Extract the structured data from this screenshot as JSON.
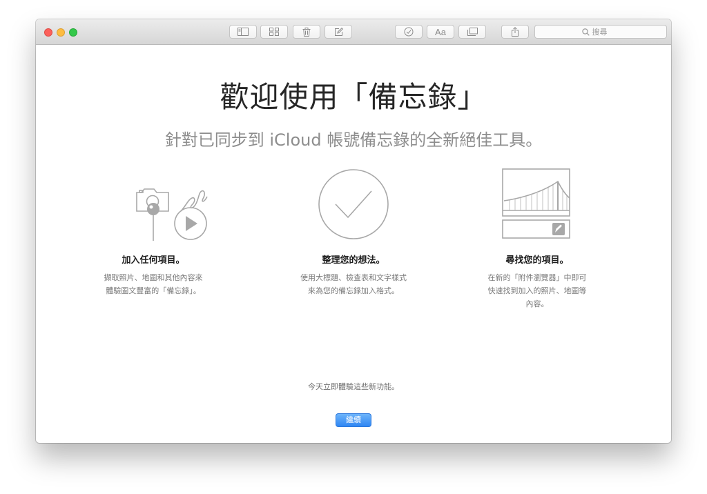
{
  "toolbar": {
    "buttons": [
      {
        "name": "sidebar-toggle-icon"
      },
      {
        "name": "attachments-grid-icon"
      },
      {
        "name": "trash-icon"
      },
      {
        "name": "compose-icon"
      },
      {
        "name": "checklist-icon"
      },
      {
        "name": "format-text-icon",
        "label": "Aa"
      },
      {
        "name": "gallery-icon"
      },
      {
        "name": "share-icon"
      }
    ],
    "search_placeholder": "搜尋"
  },
  "welcome": {
    "title": "歡迎使用「備忘錄」",
    "subtitle": "針對已同步到 iCloud 帳號備忘錄的全新絕佳工具。"
  },
  "features": [
    {
      "icon": "media-collage-icon",
      "title": "加入任何項目。",
      "description": "擷取照片、地圖和其他內容來\n體驗圖文豐富的「備忘錄」。"
    },
    {
      "icon": "checkmark-circle-icon",
      "title": "整理您的想法。",
      "description": "使用大標題、檢查表和文字樣式\n來為您的備忘錄加入格式。"
    },
    {
      "icon": "attachment-browser-icon",
      "title": "尋找您的項目。",
      "description": "在新的「附件瀏覽器」中即可\n快速找到加入的照片、地圖等\n內容。"
    }
  ],
  "cta": {
    "text": "今天立即體驗這些新功能。",
    "button_label": "繼續"
  },
  "colors": {
    "accent": "#3a8ef6",
    "close": "#fc605b",
    "minimize": "#fdbc40",
    "maximize": "#34c84a"
  }
}
